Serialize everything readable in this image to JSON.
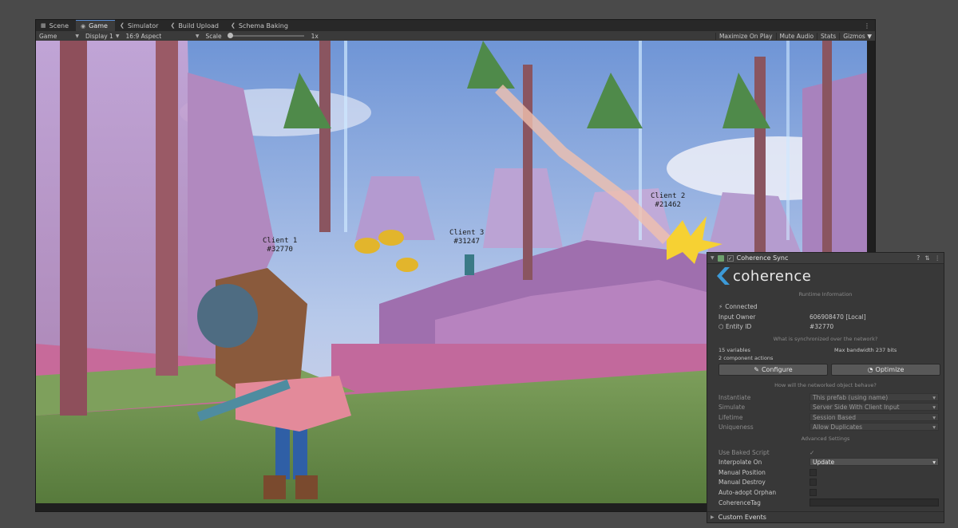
{
  "tabs": [
    {
      "label": "Scene",
      "icon": "scene-icon"
    },
    {
      "label": "Game",
      "icon": "gamepad-icon"
    },
    {
      "label": "Simulator",
      "icon": "coherence-icon"
    },
    {
      "label": "Build Upload",
      "icon": "coherence-icon"
    },
    {
      "label": "Schema Baking",
      "icon": "coherence-icon"
    }
  ],
  "toolbar": {
    "game_dropdown": "Game",
    "display_dropdown": "Display 1",
    "aspect_dropdown": "16:9 Aspect",
    "scale_label": "Scale",
    "scale_value": "1x",
    "scale_fraction": 0,
    "maximize": "Maximize On Play",
    "mute": "Mute Audio",
    "stats": "Stats",
    "gizmos": "Gizmos"
  },
  "clients": [
    {
      "name": "Client 1",
      "id": "#32770"
    },
    {
      "name": "Client 3",
      "id": "#31247"
    },
    {
      "name": "Client 2",
      "id": "#21462"
    }
  ],
  "panel": {
    "title": "Coherence Sync",
    "logo_text": "coherence",
    "runtime_header": "Runtime Information",
    "status": "Connected",
    "input_owner_label": "Input Owner",
    "input_owner_value": "606908470 [Local]",
    "entity_id_label": "Entity ID",
    "entity_id_value": "#32770",
    "sync_header": "What is synchronized over the network?",
    "variables": "15 variables",
    "bandwidth_label": "Max bandwidth",
    "bandwidth_value": "237 bits",
    "component_actions": "2 component actions",
    "configure": "Configure",
    "optimize": "Optimize",
    "behave_header": "How will the networked object behave?",
    "instantiate_label": "Instantiate",
    "instantiate_value": "This prefab (using name)",
    "simulate_label": "Simulate",
    "simulate_value": "Server Side With Client Input",
    "lifetime_label": "Lifetime",
    "lifetime_value": "Session Based",
    "uniqueness_label": "Uniqueness",
    "uniqueness_value": "Allow Duplicates",
    "advanced_header": "Advanced Settings",
    "baked_label": "Use Baked Script",
    "interpolate_label": "Interpolate On",
    "interpolate_value": "Update",
    "manual_position_label": "Manual Position",
    "manual_destroy_label": "Manual Destroy",
    "auto_adopt_label": "Auto-adopt Orphan",
    "tag_label": "CoherenceTag",
    "custom_events": "Custom Events"
  },
  "colors": {
    "editor_bg": "#1f1f1f",
    "panel_bg": "#383838",
    "accent_blue": "#5a8fd8",
    "logo_blue": "#3c9ad8"
  }
}
